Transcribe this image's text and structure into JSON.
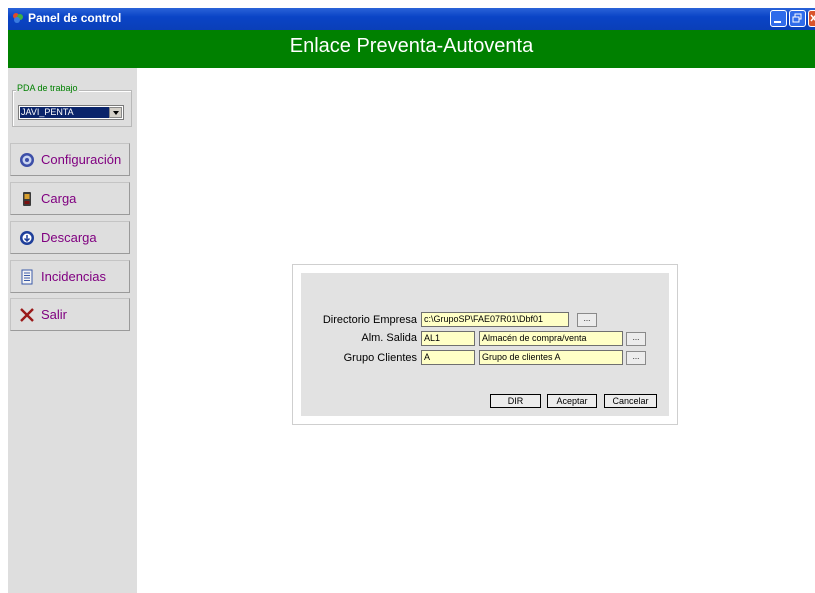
{
  "window": {
    "title": "Panel de control"
  },
  "header": {
    "title": "Enlace Preventa-Autoventa"
  },
  "sidebar": {
    "pda_label": "PDA de trabajo",
    "pda_selected": "JAVI_PENTA",
    "items": [
      {
        "label": "Configuración",
        "icon": "gear-icon"
      },
      {
        "label": "Carga",
        "icon": "device-icon"
      },
      {
        "label": "Descarga",
        "icon": "download-icon"
      },
      {
        "label": "Incidencias",
        "icon": "document-icon"
      },
      {
        "label": "Salir",
        "icon": "close-icon"
      }
    ]
  },
  "dialog": {
    "directorio": {
      "label": "Directorio Empresa",
      "value": "c:\\GrupoSP\\FAE07R01\\Dbf01"
    },
    "almacen": {
      "label": "Alm. Salida",
      "code": "AL1",
      "desc": "Almacén de compra/venta"
    },
    "grupo": {
      "label": "Grupo Clientes",
      "code": "A",
      "desc": "Grupo de clientes A"
    },
    "browse_label": "...",
    "buttons": {
      "dir": "DIR",
      "ok": "Aceptar",
      "cancel": "Cancelar"
    }
  },
  "colors": {
    "header": "#008000",
    "titlebar": "#0a44c6",
    "field": "#ffffc6",
    "nav_text": "#800080"
  }
}
